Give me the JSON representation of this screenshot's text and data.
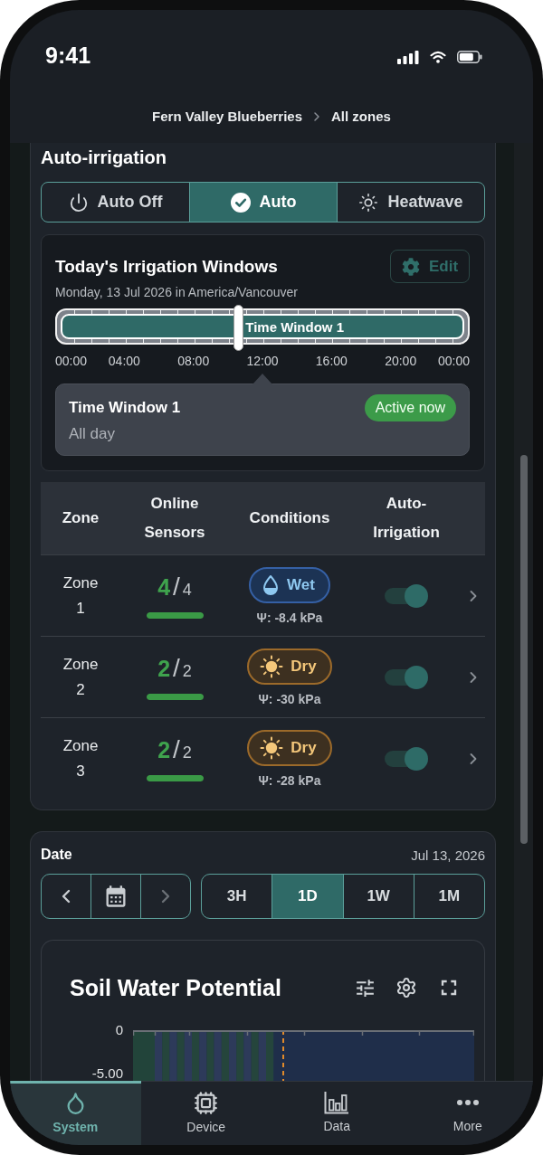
{
  "status_bar": {
    "time": "9:41"
  },
  "breadcrumb": [
    {
      "label": "Fern Valley Blueberries"
    },
    {
      "label": "All zones"
    }
  ],
  "auto_irrigation": {
    "title": "Auto-irrigation",
    "modes": [
      {
        "kind": "off",
        "label": "Auto Off",
        "selected": false
      },
      {
        "kind": "auto",
        "label": "Auto",
        "selected": true
      },
      {
        "kind": "heatwave",
        "label": "Heatwave",
        "selected": false
      }
    ]
  },
  "irrigation_windows": {
    "title": "Today's Irrigation Windows",
    "edit_button": "Edit",
    "date": "Monday, 13 Jul 2026 in America/Vancouver",
    "windows": [
      {
        "label": "Time Window 1"
      }
    ],
    "now_marker": {
      "level": 0.44
    },
    "hours": [
      "00:00",
      "04:00",
      "08:00",
      "12:00",
      "16:00",
      "20:00",
      "00:00"
    ],
    "selected_window": {
      "title": "Time Window 1",
      "time": "All day",
      "badge": "Active now"
    }
  },
  "zones_table": {
    "columns": [
      "Zone",
      "Online Sensors",
      "Conditions",
      "Auto-Irrigation"
    ],
    "rows": [
      {
        "zone": "Zone 1",
        "sensors": {
          "online": "4",
          "separator": "/",
          "total": "4",
          "level": 1
        },
        "condition": {
          "kind": "wet",
          "label": "Wet"
        },
        "reading": "Ψ: -8.4 kPa",
        "auto_on": true
      },
      {
        "zone": "Zone 2",
        "sensors": {
          "online": "2",
          "separator": "/",
          "total": "2",
          "level": 1
        },
        "condition": {
          "kind": "dry",
          "label": "Dry"
        },
        "reading": "Ψ: -30 kPa",
        "auto_on": true
      },
      {
        "zone": "Zone 3",
        "sensors": {
          "online": "2",
          "separator": "/",
          "total": "2",
          "level": 1
        },
        "condition": {
          "kind": "dry",
          "label": "Dry"
        },
        "reading": "Ψ: -28 kPa",
        "auto_on": true
      }
    ]
  },
  "date_panel": {
    "title": "Date",
    "date": "Jul 13, 2026",
    "nav": [
      {
        "kind": "prev",
        "disabled": false
      },
      {
        "kind": "calendar",
        "disabled": false
      },
      {
        "kind": "next",
        "disabled": true
      }
    ],
    "ranges": [
      {
        "label": "3H",
        "selected": false
      },
      {
        "label": "1D",
        "selected": true
      },
      {
        "label": "1W",
        "selected": false
      },
      {
        "label": "1M",
        "selected": false
      }
    ]
  },
  "chart": {
    "title": "Soil Water Potential",
    "y_labels": [
      "0",
      "-5.00"
    ]
  },
  "bottom_nav": [
    {
      "kind": "system",
      "label": "System",
      "selected": true
    },
    {
      "kind": "device",
      "label": "Device",
      "selected": false
    },
    {
      "kind": "data",
      "label": "Data",
      "selected": false
    },
    {
      "kind": "more",
      "label": "More",
      "selected": false
    }
  ]
}
